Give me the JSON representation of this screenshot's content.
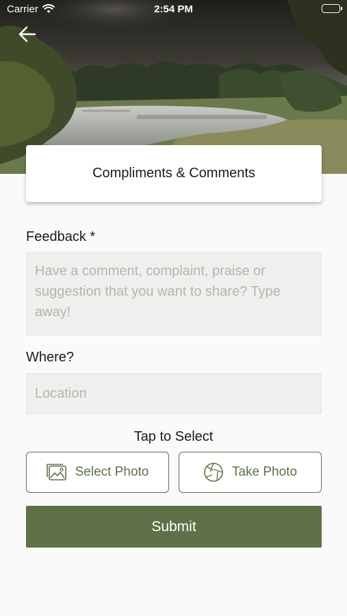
{
  "status_bar": {
    "carrier": "Carrier",
    "time": "2:54 PM"
  },
  "header": {
    "title": "Compliments & Comments"
  },
  "form": {
    "feedback": {
      "label": "Feedback *",
      "value": "",
      "placeholder": "Have a comment, complaint, praise or suggestion that you want to share? Type away!"
    },
    "where": {
      "label": "Where?",
      "value": "",
      "placeholder": "Location"
    },
    "photo": {
      "prompt": "Tap to Select",
      "select_label": "Select Photo",
      "take_label": "Take Photo"
    },
    "submit_label": "Submit"
  },
  "icons": {
    "back": "arrow-left-icon",
    "wifi": "wifi-icon",
    "battery": "battery-icon",
    "select_photo": "image-icon",
    "take_photo": "camera-aperture-icon"
  },
  "colors": {
    "accent": "#5e7148",
    "field_bg": "#f0efed",
    "placeholder": "#b6b4ae",
    "background": "#fafafa"
  }
}
